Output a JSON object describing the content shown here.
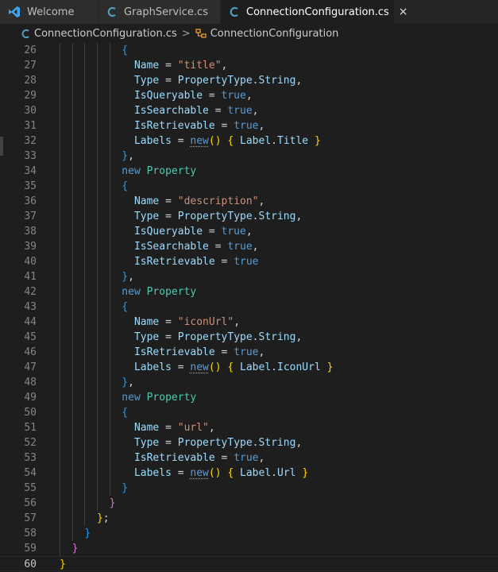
{
  "tabs": [
    {
      "label": "Welcome",
      "icon": "vscode-logo-icon",
      "active": false
    },
    {
      "label": "GraphService.cs",
      "icon": "csharp-file-icon",
      "active": false
    },
    {
      "label": "ConnectionConfiguration.cs",
      "icon": "csharp-file-icon",
      "active": true,
      "close": "×"
    }
  ],
  "breadcrumb": {
    "file": "ConnectionConfiguration.cs",
    "separator": ">",
    "symbol": "ConnectionConfiguration"
  },
  "editor": {
    "current_line": 60,
    "lines": [
      {
        "n": "26",
        "indent": 10,
        "tokens": [
          [
            "{",
            "b3"
          ]
        ]
      },
      {
        "n": "27",
        "indent": 12,
        "tokens": [
          [
            "Name",
            "prop"
          ],
          [
            " = ",
            "punc"
          ],
          [
            "\"title\"",
            "str"
          ],
          [
            ",",
            "punc"
          ]
        ]
      },
      {
        "n": "28",
        "indent": 12,
        "tokens": [
          [
            "Type",
            "prop"
          ],
          [
            " = ",
            "punc"
          ],
          [
            "PropertyType",
            "prop"
          ],
          [
            ".",
            "punc"
          ],
          [
            "String",
            "prop"
          ],
          [
            ",",
            "punc"
          ]
        ]
      },
      {
        "n": "29",
        "indent": 12,
        "tokens": [
          [
            "IsQueryable",
            "prop"
          ],
          [
            " = ",
            "punc"
          ],
          [
            "true",
            "kw"
          ],
          [
            ",",
            "punc"
          ]
        ]
      },
      {
        "n": "30",
        "indent": 12,
        "tokens": [
          [
            "IsSearchable",
            "prop"
          ],
          [
            " = ",
            "punc"
          ],
          [
            "true",
            "kw"
          ],
          [
            ",",
            "punc"
          ]
        ]
      },
      {
        "n": "31",
        "indent": 12,
        "tokens": [
          [
            "IsRetrievable",
            "prop"
          ],
          [
            " = ",
            "punc"
          ],
          [
            "true",
            "kw"
          ],
          [
            ",",
            "punc"
          ]
        ]
      },
      {
        "n": "32",
        "indent": 12,
        "tokens": [
          [
            "Labels",
            "prop"
          ],
          [
            " = ",
            "punc"
          ],
          [
            "new",
            "kw dots"
          ],
          [
            "()",
            "b1"
          ],
          [
            " ",
            "punc"
          ],
          [
            "{",
            "b1"
          ],
          [
            " Label",
            "prop"
          ],
          [
            ".",
            "punc"
          ],
          [
            "Title",
            "prop"
          ],
          [
            " ",
            "punc"
          ],
          [
            "}",
            "b1"
          ]
        ]
      },
      {
        "n": "33",
        "indent": 10,
        "tokens": [
          [
            "}",
            "b3"
          ],
          [
            ",",
            "punc"
          ]
        ]
      },
      {
        "n": "34",
        "indent": 10,
        "tokens": [
          [
            "new",
            "kw"
          ],
          [
            " ",
            "punc"
          ],
          [
            "Property",
            "type"
          ]
        ]
      },
      {
        "n": "35",
        "indent": 10,
        "tokens": [
          [
            "{",
            "b3"
          ]
        ]
      },
      {
        "n": "36",
        "indent": 12,
        "tokens": [
          [
            "Name",
            "prop"
          ],
          [
            " = ",
            "punc"
          ],
          [
            "\"description\"",
            "str"
          ],
          [
            ",",
            "punc"
          ]
        ]
      },
      {
        "n": "37",
        "indent": 12,
        "tokens": [
          [
            "Type",
            "prop"
          ],
          [
            " = ",
            "punc"
          ],
          [
            "PropertyType",
            "prop"
          ],
          [
            ".",
            "punc"
          ],
          [
            "String",
            "prop"
          ],
          [
            ",",
            "punc"
          ]
        ]
      },
      {
        "n": "38",
        "indent": 12,
        "tokens": [
          [
            "IsQueryable",
            "prop"
          ],
          [
            " = ",
            "punc"
          ],
          [
            "true",
            "kw"
          ],
          [
            ",",
            "punc"
          ]
        ]
      },
      {
        "n": "39",
        "indent": 12,
        "tokens": [
          [
            "IsSearchable",
            "prop"
          ],
          [
            " = ",
            "punc"
          ],
          [
            "true",
            "kw"
          ],
          [
            ",",
            "punc"
          ]
        ]
      },
      {
        "n": "40",
        "indent": 12,
        "tokens": [
          [
            "IsRetrievable",
            "prop"
          ],
          [
            " = ",
            "punc"
          ],
          [
            "true",
            "kw"
          ]
        ]
      },
      {
        "n": "41",
        "indent": 10,
        "tokens": [
          [
            "}",
            "b3"
          ],
          [
            ",",
            "punc"
          ]
        ]
      },
      {
        "n": "42",
        "indent": 10,
        "tokens": [
          [
            "new",
            "kw"
          ],
          [
            " ",
            "punc"
          ],
          [
            "Property",
            "type"
          ]
        ]
      },
      {
        "n": "43",
        "indent": 10,
        "tokens": [
          [
            "{",
            "b3"
          ]
        ]
      },
      {
        "n": "44",
        "indent": 12,
        "tokens": [
          [
            "Name",
            "prop"
          ],
          [
            " = ",
            "punc"
          ],
          [
            "\"iconUrl\"",
            "str"
          ],
          [
            ",",
            "punc"
          ]
        ]
      },
      {
        "n": "45",
        "indent": 12,
        "tokens": [
          [
            "Type",
            "prop"
          ],
          [
            " = ",
            "punc"
          ],
          [
            "PropertyType",
            "prop"
          ],
          [
            ".",
            "punc"
          ],
          [
            "String",
            "prop"
          ],
          [
            ",",
            "punc"
          ]
        ]
      },
      {
        "n": "46",
        "indent": 12,
        "tokens": [
          [
            "IsRetrievable",
            "prop"
          ],
          [
            " = ",
            "punc"
          ],
          [
            "true",
            "kw"
          ],
          [
            ",",
            "punc"
          ]
        ]
      },
      {
        "n": "47",
        "indent": 12,
        "tokens": [
          [
            "Labels",
            "prop"
          ],
          [
            " = ",
            "punc"
          ],
          [
            "new",
            "kw dots"
          ],
          [
            "()",
            "b1"
          ],
          [
            " ",
            "punc"
          ],
          [
            "{",
            "b1"
          ],
          [
            " Label",
            "prop"
          ],
          [
            ".",
            "punc"
          ],
          [
            "IconUrl",
            "prop"
          ],
          [
            " ",
            "punc"
          ],
          [
            "}",
            "b1"
          ]
        ]
      },
      {
        "n": "48",
        "indent": 10,
        "tokens": [
          [
            "}",
            "b3"
          ],
          [
            ",",
            "punc"
          ]
        ]
      },
      {
        "n": "49",
        "indent": 10,
        "tokens": [
          [
            "new",
            "kw"
          ],
          [
            " ",
            "punc"
          ],
          [
            "Property",
            "type"
          ]
        ]
      },
      {
        "n": "50",
        "indent": 10,
        "tokens": [
          [
            "{",
            "b3"
          ]
        ]
      },
      {
        "n": "51",
        "indent": 12,
        "tokens": [
          [
            "Name",
            "prop"
          ],
          [
            " = ",
            "punc"
          ],
          [
            "\"url\"",
            "str"
          ],
          [
            ",",
            "punc"
          ]
        ]
      },
      {
        "n": "52",
        "indent": 12,
        "tokens": [
          [
            "Type",
            "prop"
          ],
          [
            " = ",
            "punc"
          ],
          [
            "PropertyType",
            "prop"
          ],
          [
            ".",
            "punc"
          ],
          [
            "String",
            "prop"
          ],
          [
            ",",
            "punc"
          ]
        ]
      },
      {
        "n": "53",
        "indent": 12,
        "tokens": [
          [
            "IsRetrievable",
            "prop"
          ],
          [
            " = ",
            "punc"
          ],
          [
            "true",
            "kw"
          ],
          [
            ",",
            "punc"
          ]
        ]
      },
      {
        "n": "54",
        "indent": 12,
        "tokens": [
          [
            "Labels",
            "prop"
          ],
          [
            " = ",
            "punc"
          ],
          [
            "new",
            "kw dots"
          ],
          [
            "()",
            "b1"
          ],
          [
            " ",
            "punc"
          ],
          [
            "{",
            "b1"
          ],
          [
            " Label",
            "prop"
          ],
          [
            ".",
            "punc"
          ],
          [
            "Url",
            "prop"
          ],
          [
            " ",
            "punc"
          ],
          [
            "}",
            "b1"
          ]
        ]
      },
      {
        "n": "55",
        "indent": 10,
        "tokens": [
          [
            "}",
            "b3"
          ]
        ]
      },
      {
        "n": "56",
        "indent": 8,
        "tokens": [
          [
            "}",
            "b2"
          ]
        ]
      },
      {
        "n": "57",
        "indent": 6,
        "tokens": [
          [
            "}",
            "b1"
          ],
          [
            ";",
            "punc"
          ]
        ]
      },
      {
        "n": "58",
        "indent": 4,
        "tokens": [
          [
            "}",
            "b3"
          ]
        ]
      },
      {
        "n": "59",
        "indent": 2,
        "tokens": [
          [
            "}",
            "b2"
          ]
        ]
      },
      {
        "n": "60",
        "indent": 0,
        "tokens": [
          [
            "}",
            "b1"
          ]
        ]
      }
    ]
  },
  "colors": {
    "background": "#1e1e1e",
    "tab_bar": "#252526",
    "keyword": "#569cd6",
    "type": "#4ec9b0",
    "property": "#9cdcfe",
    "string": "#ce9178",
    "bracket_gold": "#ffd700",
    "bracket_orchid": "#da70d6",
    "bracket_blue": "#179fff"
  }
}
